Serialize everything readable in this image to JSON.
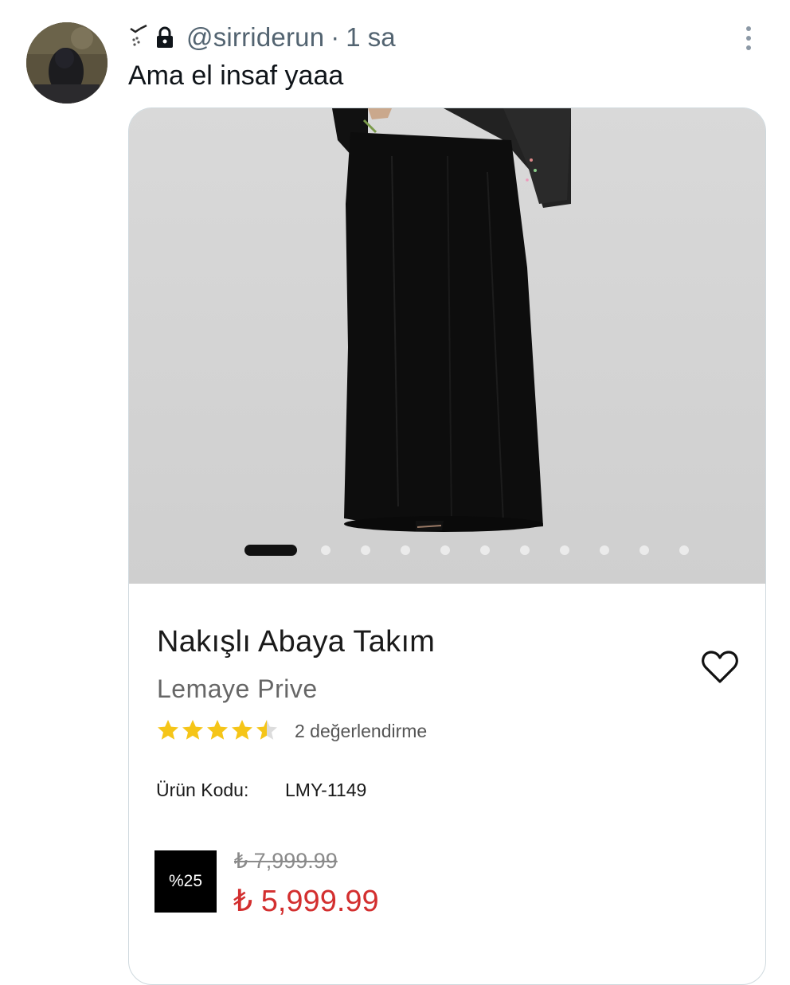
{
  "tweet": {
    "handle": "@sirriderun",
    "separator": "·",
    "time": "1 sa",
    "text": "Ama el insaf yaaa"
  },
  "icons": {
    "avatar": "profile-photo",
    "emoji": "bird-emoji",
    "lock": "lock-icon",
    "more": "more-vertical-icon",
    "favorite": "heart-icon",
    "rating": "star-icon"
  },
  "product": {
    "title": "Nakışlı Abaya Takım",
    "brand": "Lemaye Prive",
    "rating": 4.5,
    "rating_max": 5,
    "review_count_text": "2 değerlendirme",
    "code_label": "Ürün Kodu:",
    "code_value": "LMY-1149",
    "discount": "%25",
    "old_price": "₺ 7,999.99",
    "new_price": "₺ 5,999.99",
    "gallery_total": 11,
    "gallery_active": 1
  },
  "colors": {
    "text_primary": "#0f1419",
    "text_secondary": "#536471",
    "card_border": "#cfd9de",
    "price_red": "#d32f2f",
    "star_gold": "#f5c518",
    "photo_bg": "#d6d6d6"
  }
}
